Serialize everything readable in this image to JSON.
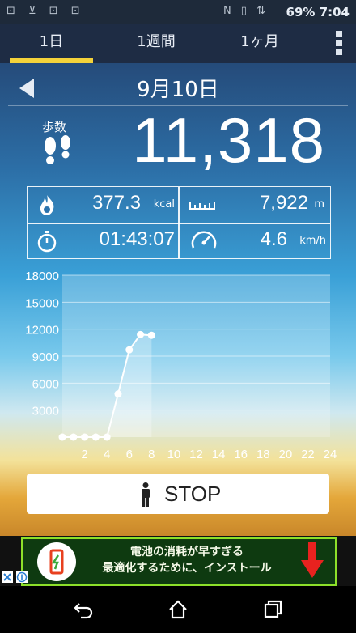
{
  "status_bar": {
    "left_icons": "⊡ ⊻ ⊡ ⊡",
    "mid_icons": "N ▯ ⇅",
    "battery": "69%",
    "time": "7:04"
  },
  "tabs": [
    {
      "label": "1日",
      "active": true
    },
    {
      "label": "1週間",
      "active": false
    },
    {
      "label": "1ヶ月",
      "active": false
    }
  ],
  "date": "9月10日",
  "steps": {
    "label": "歩数",
    "value": "11,318"
  },
  "stats": {
    "calories": {
      "value": "377.3",
      "unit": "kcal"
    },
    "distance": {
      "value": "7,922",
      "unit": "m"
    },
    "duration": {
      "value": "01:43:07"
    },
    "speed": {
      "value": "4.6",
      "unit": "km/h"
    }
  },
  "chart_data": {
    "type": "area",
    "ylim": [
      0,
      18000
    ],
    "xlim": [
      0,
      24
    ],
    "yticks": [
      "18000",
      "15000",
      "12000",
      "9000",
      "6000",
      "3000"
    ],
    "xticks": [
      "2",
      "4",
      "6",
      "8",
      "10",
      "12",
      "14",
      "16",
      "18",
      "20",
      "22",
      "24"
    ],
    "x": [
      0,
      1,
      2,
      3,
      4,
      5,
      6,
      7,
      8
    ],
    "values": [
      0,
      0,
      0,
      0,
      0,
      4800,
      9700,
      11400,
      11318
    ],
    "grid": true
  },
  "stop_button": {
    "label": "STOP"
  },
  "ad": {
    "line1": "電池の消耗が早すぎる",
    "line2": "最適化するために、インストール"
  },
  "colors": {
    "accent": "#f4d23a",
    "tabbar": "#1e2c44",
    "ad_border": "#8de02a",
    "ad_arrow": "#e8221f"
  }
}
